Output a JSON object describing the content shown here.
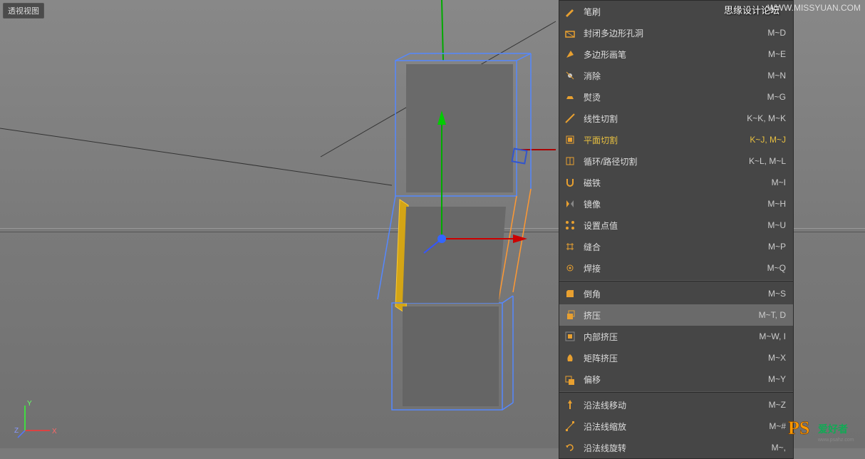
{
  "viewport": {
    "label": "透视视图"
  },
  "watermarks": {
    "top_right_url": "WWW.MISSYUAN.COM",
    "top_right_text": "思缘设计论坛",
    "bottom_right": "PS 爱好者"
  },
  "axes": {
    "x": "X",
    "y": "Y",
    "z": "Z"
  },
  "menu": {
    "items": [
      {
        "label": "笔刷",
        "shortcut": "",
        "icon": "brush"
      },
      {
        "label": "封闭多边形孔洞",
        "shortcut": "M~D",
        "icon": "close-hole"
      },
      {
        "label": "多边形画笔",
        "shortcut": "M~E",
        "icon": "poly-pen"
      },
      {
        "label": "消除",
        "shortcut": "M~N",
        "icon": "dissolve"
      },
      {
        "label": "熨烫",
        "shortcut": "M~G",
        "icon": "iron"
      },
      {
        "label": "线性切割",
        "shortcut": "K~K, M~K",
        "icon": "knife"
      },
      {
        "label": "平面切割",
        "shortcut": "K~J, M~J",
        "icon": "plane-cut",
        "highlighted": true
      },
      {
        "label": "循环/路径切割",
        "shortcut": "K~L, M~L",
        "icon": "loop-cut"
      },
      {
        "label": "磁铁",
        "shortcut": "M~I",
        "icon": "magnet"
      },
      {
        "label": "镜像",
        "shortcut": "M~H",
        "icon": "mirror"
      },
      {
        "label": "设置点值",
        "shortcut": "M~U",
        "icon": "set-point"
      },
      {
        "label": "缝合",
        "shortcut": "M~P",
        "icon": "stitch"
      },
      {
        "label": "焊接",
        "shortcut": "M~Q",
        "icon": "weld"
      }
    ],
    "items2": [
      {
        "label": "倒角",
        "shortcut": "M~S",
        "icon": "bevel"
      },
      {
        "label": "挤压",
        "shortcut": "M~T, D",
        "icon": "extrude",
        "selected": true
      },
      {
        "label": "内部挤压",
        "shortcut": "M~W, I",
        "icon": "inner-extrude"
      },
      {
        "label": "矩阵挤压",
        "shortcut": "M~X",
        "icon": "matrix-extrude"
      },
      {
        "label": "偏移",
        "shortcut": "M~Y",
        "icon": "offset"
      }
    ],
    "items3": [
      {
        "label": "沿法线移动",
        "shortcut": "M~Z",
        "icon": "normal-move"
      },
      {
        "label": "沿法线缩放",
        "shortcut": "M~#",
        "icon": "normal-scale"
      },
      {
        "label": "沿法线旋转",
        "shortcut": "M~,",
        "icon": "normal-rotate"
      }
    ]
  }
}
